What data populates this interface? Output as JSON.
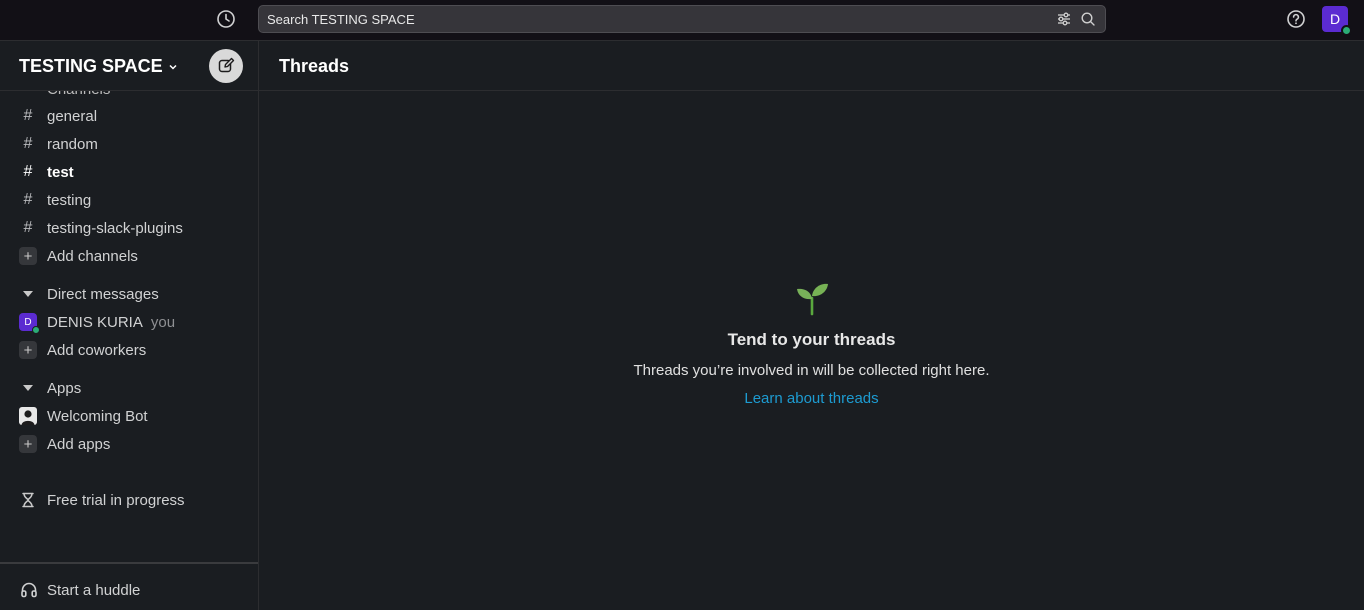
{
  "topbar": {
    "search_placeholder": "Search TESTING SPACE",
    "avatar_initial": "D",
    "history_icon": "clock-icon",
    "filter_icon": "sliders-icon",
    "search_icon": "magnifier-icon",
    "help_icon": "question-circle-icon",
    "accent_color": "#5b2bd1",
    "presence_color": "#2bac76"
  },
  "sidebar": {
    "workspace_name": "TESTING SPACE",
    "channels_heading": "Channels",
    "channels": [
      {
        "name": "general",
        "unread": false
      },
      {
        "name": "random",
        "unread": false
      },
      {
        "name": "test",
        "unread": true
      },
      {
        "name": "testing",
        "unread": false
      },
      {
        "name": "testing-slack-plugins",
        "unread": false
      }
    ],
    "add_channels_label": "Add channels",
    "dm_heading": "Direct messages",
    "dm_user": {
      "name": "DENIS KURIA",
      "initial": "D",
      "suffix": "you"
    },
    "add_coworkers_label": "Add coworkers",
    "apps_heading": "Apps",
    "apps": [
      {
        "name": "Welcoming Bot"
      }
    ],
    "add_apps_label": "Add apps",
    "trial_label": "Free trial in progress",
    "huddle_label": "Start a huddle"
  },
  "main": {
    "title": "Threads",
    "empty_state": {
      "icon": "sprout-icon",
      "heading": "Tend to your threads",
      "description": "Threads you’re involved in will be collected right here.",
      "link": "Learn about threads",
      "link_color": "#1d9bd1"
    }
  }
}
